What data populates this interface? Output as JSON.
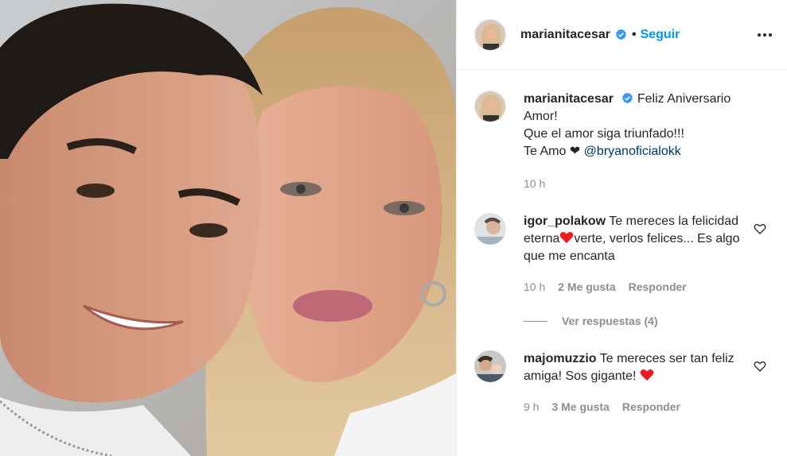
{
  "post": {
    "username": "marianitacesar",
    "follow_label": "Seguir",
    "dot": "•"
  },
  "caption": {
    "username": "marianitacesar",
    "line1": "Feliz Aniversario",
    "line2": "Amor!",
    "line3": "Que el amor siga triunfado!!!",
    "line4_prefix": "Te Amo ❤",
    "mention": "@bryanoficialokk",
    "time": "10 h"
  },
  "comments": [
    {
      "username": "igor_polakow",
      "text_a": "Te mereces la felicidad eterna",
      "text_b": "verte, verlos felices... Es algo que me encanta",
      "time": "10 h",
      "likes": "2 Me gusta",
      "reply": "Responder",
      "view_replies": "Ver respuestas (4)"
    },
    {
      "username": "majomuzzio",
      "text_a": "Te mereces ser tan feliz amiga! Sos gigante!",
      "time": "9 h",
      "likes": "3 Me gusta",
      "reply": "Responder"
    }
  ],
  "colors": {
    "accent": "#0095f6",
    "verified": "#3897f0",
    "heart": "#ed4956"
  },
  "icons": [
    "verified-badge-icon",
    "more-options-icon",
    "heart-outline-icon",
    "red-heart-emoji"
  ]
}
